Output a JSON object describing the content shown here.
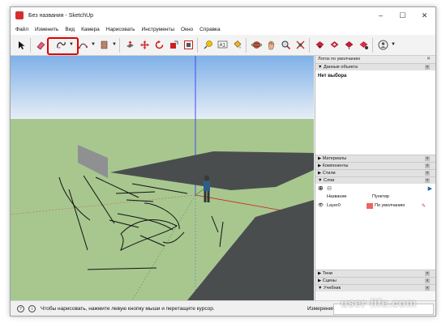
{
  "window": {
    "title": "Без названия - SketchUp",
    "controls": [
      "–",
      "☐",
      "✕"
    ]
  },
  "menu": [
    "Файл",
    "Изменить",
    "Вид",
    "Камера",
    "Нарисовать",
    "Инструменты",
    "Окно",
    "Справка"
  ],
  "toolbar": {
    "tools": [
      {
        "name": "select-icon",
        "glyph": "➤"
      },
      {
        "name": "eraser-icon",
        "glyph": "◪"
      },
      {
        "name": "freehand-icon",
        "glyph": "∿"
      },
      {
        "name": "arc-icon",
        "glyph": "⌒"
      },
      {
        "name": "rectangle-icon",
        "glyph": "▭"
      },
      {
        "name": "push-pull-icon",
        "glyph": "⬒"
      },
      {
        "name": "move-icon",
        "glyph": "✥"
      },
      {
        "name": "rotate-icon",
        "glyph": "↻"
      },
      {
        "name": "scale-icon",
        "glyph": "⤡"
      },
      {
        "name": "offset-icon",
        "glyph": "⧉"
      },
      {
        "name": "tape-measure-icon",
        "glyph": "⟟"
      },
      {
        "name": "text-icon",
        "glyph": "A1"
      },
      {
        "name": "paint-bucket-icon",
        "glyph": "⛽"
      },
      {
        "name": "orbit-icon",
        "glyph": "◎"
      },
      {
        "name": "pan-icon",
        "glyph": "✋"
      },
      {
        "name": "zoom-icon",
        "glyph": "🔍"
      },
      {
        "name": "zoom-extents-icon",
        "glyph": "⤢"
      },
      {
        "name": "warehouse-icon",
        "glyph": "◆"
      },
      {
        "name": "extension-warehouse-icon",
        "glyph": "◆"
      },
      {
        "name": "layout-icon",
        "glyph": "◆"
      },
      {
        "name": "share-model-icon",
        "glyph": "◆"
      },
      {
        "name": "account-icon",
        "glyph": "☺"
      }
    ]
  },
  "panel": {
    "tray_title": "Лоток по умолчанию",
    "entity_info": {
      "header": "Данные объекта",
      "title": "Нет выбора"
    },
    "sections": [
      "Материалы",
      "Компоненты",
      "Стили",
      "Слои"
    ],
    "layers": {
      "columns": [
        "Название",
        "Пунктир"
      ],
      "rows": [
        {
          "name": "Layer0",
          "dashes": "По умолчанию",
          "color": "#f06262"
        }
      ]
    },
    "bottom_sections": [
      "Тени",
      "Сцены",
      "Учебник"
    ]
  },
  "status": {
    "text": "Чтобы нарисовать, нажмите левую кнопку мыши и перетащите курсор.",
    "measure_label": "Измерения",
    "measure_value": ""
  },
  "watermark": "user-life.com",
  "colors": {
    "sky_top": "#7fb0e8",
    "sky_bottom": "#e6eef6",
    "ground": "#a7c78f",
    "face": "#4a4d4e",
    "highlight": "#e10000",
    "layer_color": "#f06262"
  }
}
